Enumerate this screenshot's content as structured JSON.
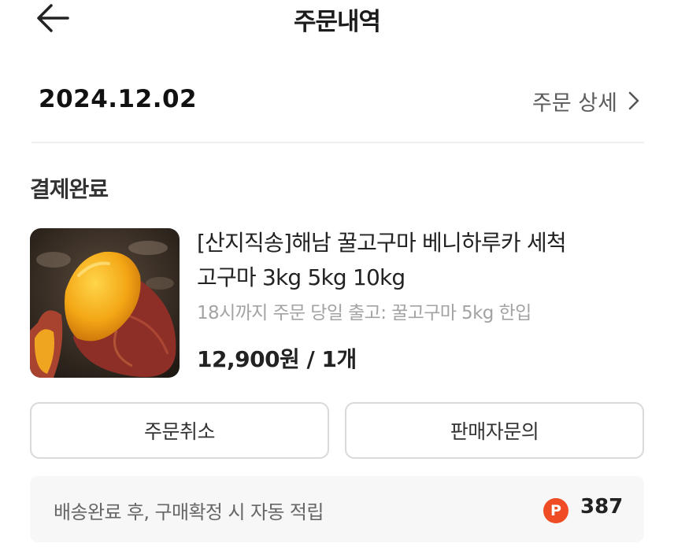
{
  "header": {
    "title": "주문내역",
    "back_icon": "arrow-left-icon"
  },
  "order": {
    "date": "2024.12.02",
    "detail_link": "주문 상세",
    "detail_icon": "chevron-right-icon",
    "status": "결제완료"
  },
  "product": {
    "name_line1": "[산지직송]해남 꿀고구마 베니하루카 세척",
    "name_line2": "고구마 3kg 5kg 10kg",
    "option": "18시까지 주문 당일 출고: 꿀고구마 5kg 한입",
    "price": "12,900원 / 1개",
    "image": "sweet-potato-photo"
  },
  "actions": {
    "cancel_label": "주문취소",
    "inquiry_label": "판매자문의"
  },
  "points": {
    "text": "배송완료 후, 구매확정 시 자동 적립",
    "badge": "P",
    "value": "387",
    "badge_color": "#ef4b24"
  }
}
